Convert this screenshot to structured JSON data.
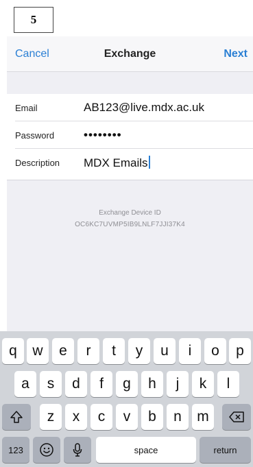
{
  "step_label": "5",
  "nav": {
    "cancel": "Cancel",
    "title": "Exchange",
    "next": "Next"
  },
  "form": {
    "email_label": "Email",
    "email_value": "AB123@live.mdx.ac.uk",
    "password_label": "Password",
    "password_value": "••••••••",
    "description_label": "Description",
    "description_value": "MDX Emails"
  },
  "device": {
    "label": "Exchange Device ID",
    "id": "OC6KC7UVMP5IB9LNLF7JJI37K4"
  },
  "keyboard": {
    "row1": [
      "q",
      "w",
      "e",
      "r",
      "t",
      "y",
      "u",
      "i",
      "o",
      "p"
    ],
    "row2": [
      "a",
      "s",
      "d",
      "f",
      "g",
      "h",
      "j",
      "k",
      "l"
    ],
    "row3": [
      "z",
      "x",
      "c",
      "v",
      "b",
      "n",
      "m"
    ],
    "numbers": "123",
    "space": "space",
    "return": "return",
    "icons": [
      "shift-icon",
      "delete-icon",
      "emoji-icon",
      "microphone-icon"
    ]
  },
  "colors": {
    "accent": "#2a7fd4",
    "keyboard_bg": "#d1d4d9",
    "secondary_bg": "#efeff4"
  }
}
